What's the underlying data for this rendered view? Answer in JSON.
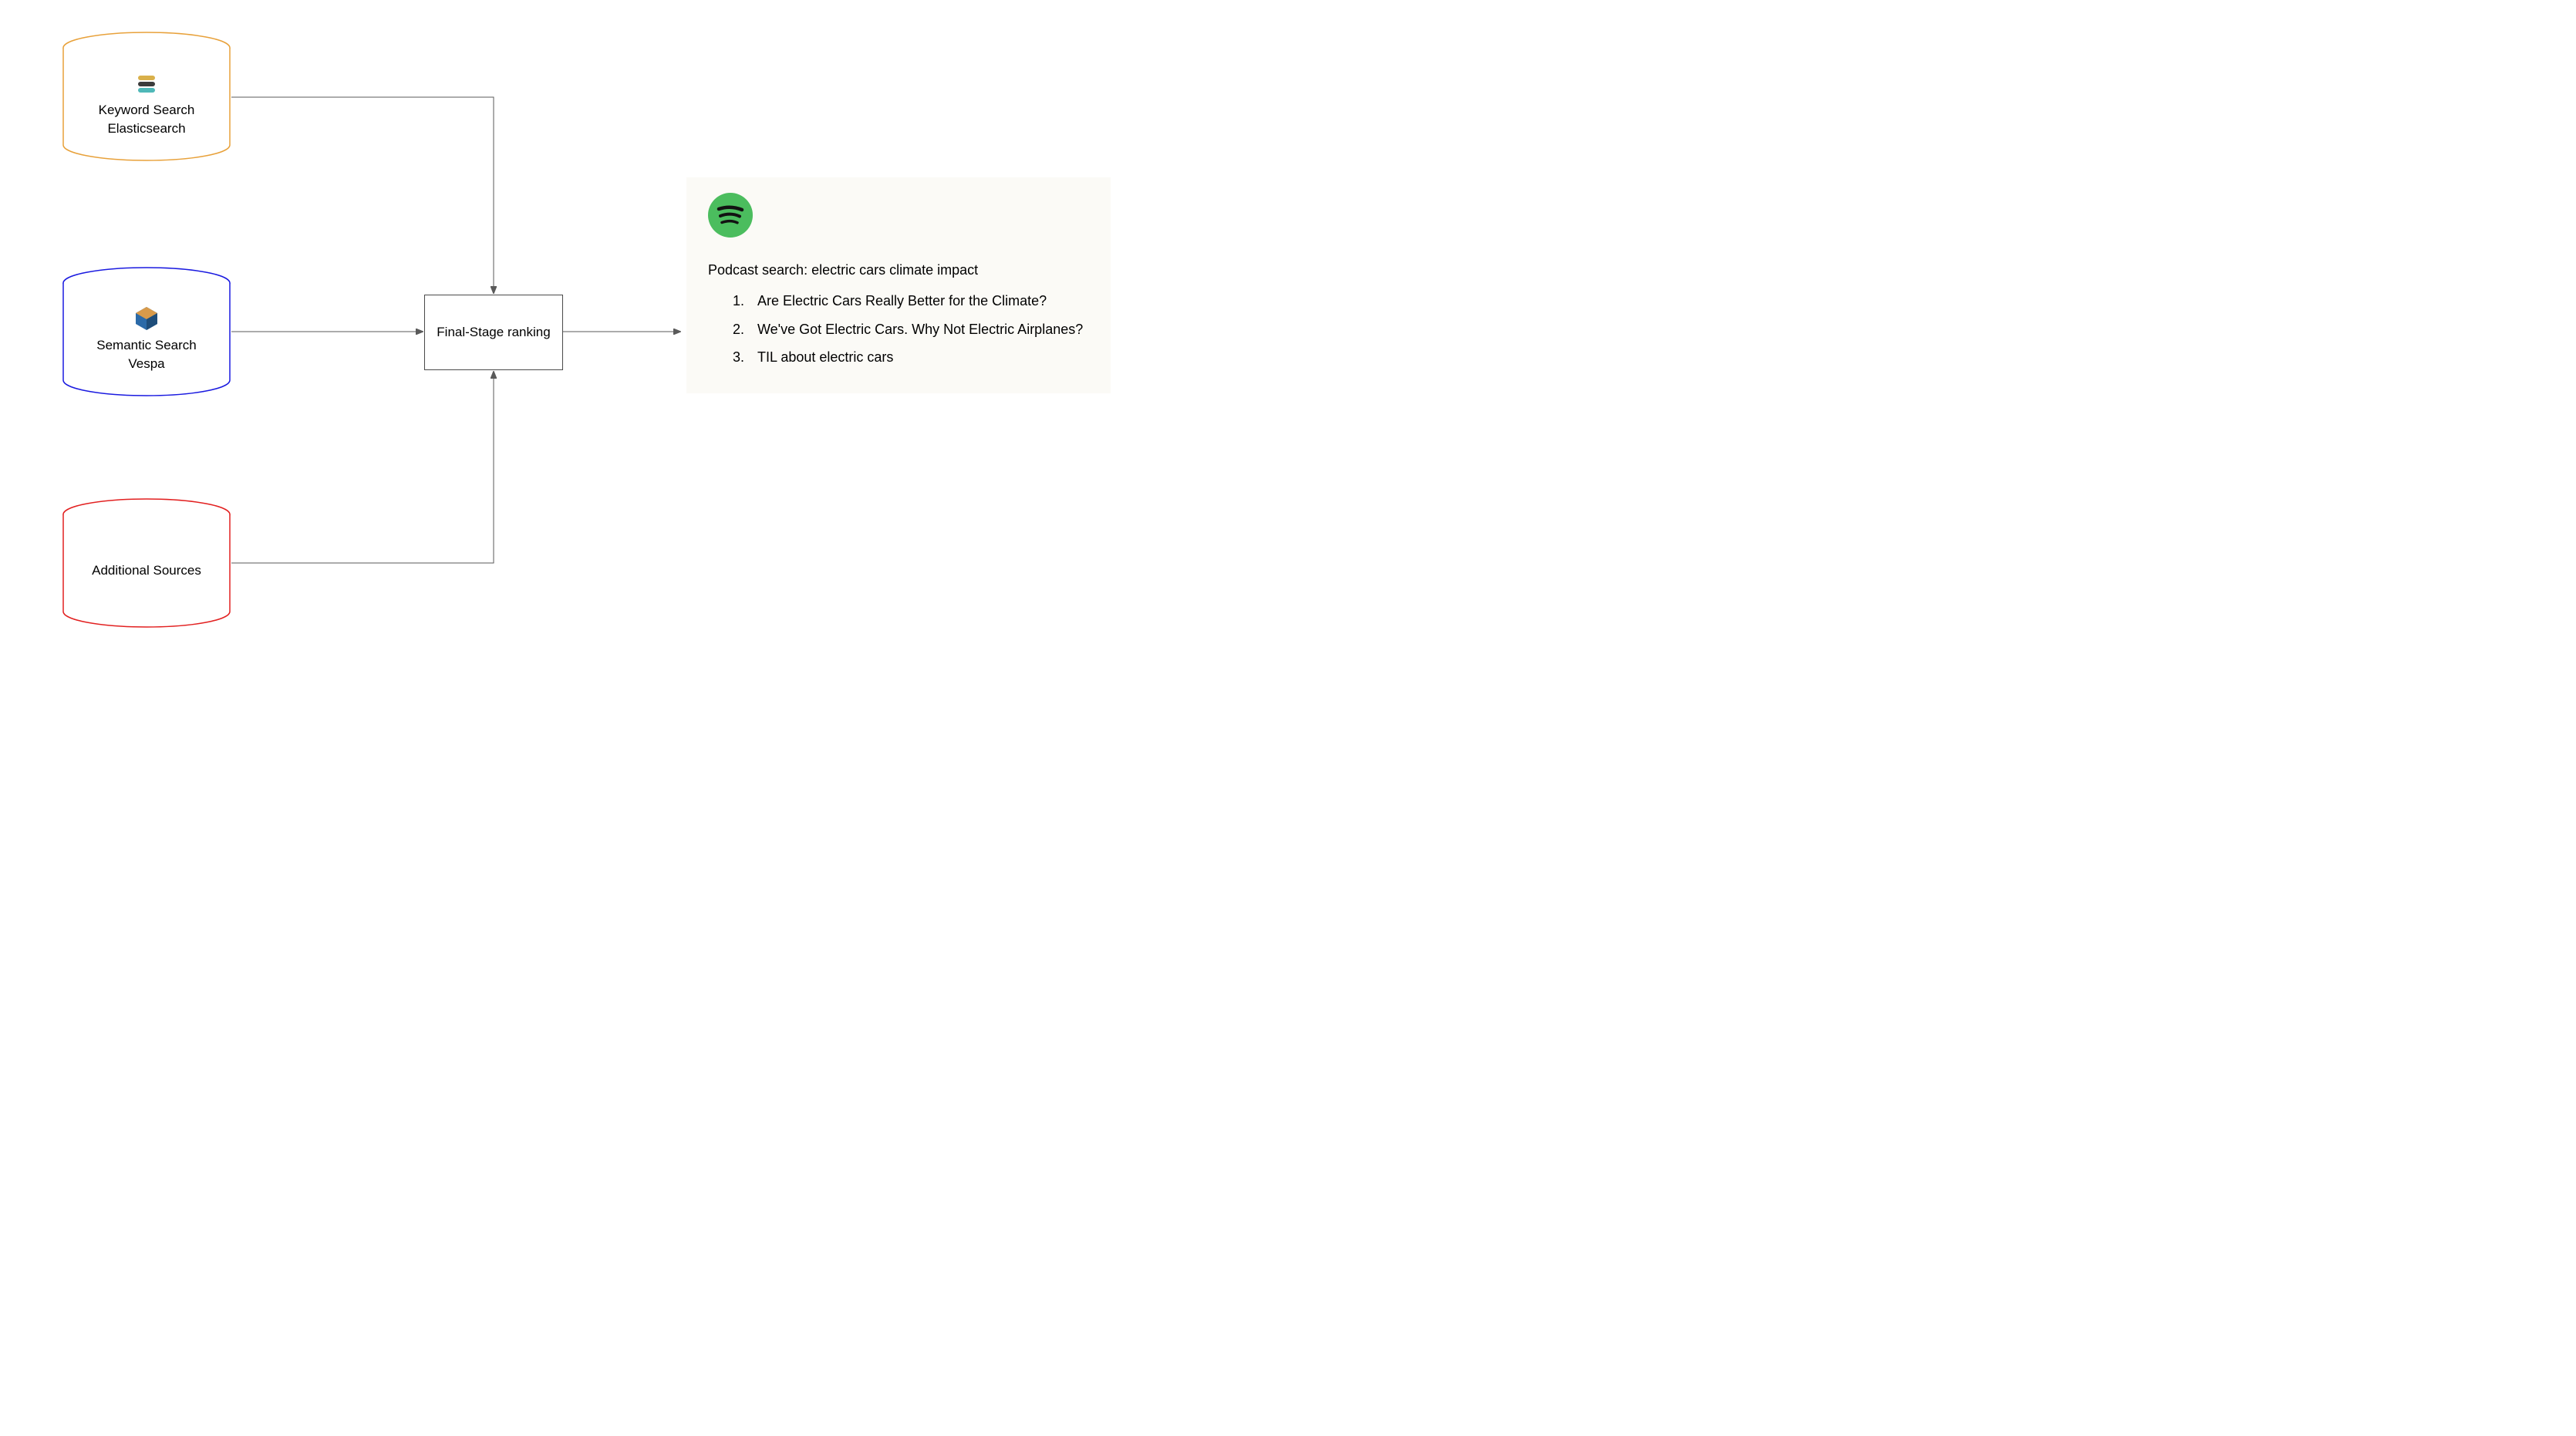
{
  "sources": {
    "keyword": {
      "line1": "Keyword Search",
      "line2": "Elasticsearch",
      "color": "#e8a13a",
      "icon": "elasticsearch-icon"
    },
    "semantic": {
      "line1": "Semantic Search",
      "line2": "Vespa",
      "color": "#1a1ae0",
      "icon": "vespa-icon"
    },
    "additional": {
      "line1": "Additional Sources",
      "color": "#e22020",
      "icon": null
    }
  },
  "ranking": {
    "label": "Final-Stage ranking"
  },
  "results": {
    "icon": "spotify-icon",
    "search_label": "Podcast search: electric cars climate impact",
    "items": [
      "Are Electric Cars Really Better for the Climate?",
      "We've Got Electric Cars. Why Not Electric Airplanes?",
      "TIL about electric cars"
    ]
  }
}
